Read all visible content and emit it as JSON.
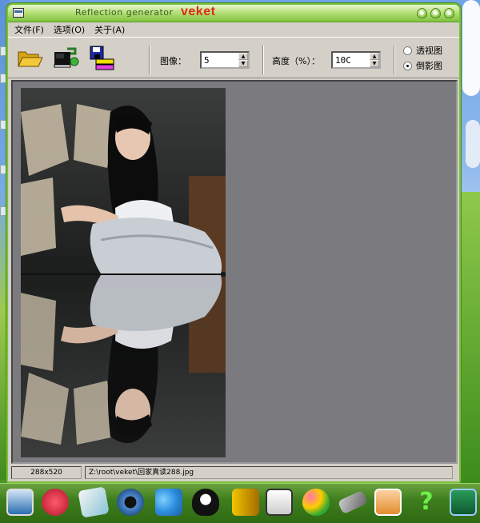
{
  "window": {
    "title": "Reflection generator",
    "brand": "veket",
    "accent_color": "#79c23b",
    "brand_color": "#e02a1a"
  },
  "menu": [
    {
      "label": "文件(F)"
    },
    {
      "label": "选项(O)"
    },
    {
      "label": "关于(A)"
    }
  ],
  "toolbar": {
    "buttons": [
      {
        "name": "open-folder-icon"
      },
      {
        "name": "export-icon"
      },
      {
        "name": "save-icon"
      }
    ],
    "image_label": "图像：",
    "image_value": "5",
    "height_label": "高度（%）：",
    "height_value": "10C",
    "radio_perspective": "透视图",
    "radio_reflection": "倒影图",
    "selected_mode": "倒影图"
  },
  "statusbar": {
    "size": "288x520",
    "path": "Z:\\root\\veket\\回家真读288.jpg"
  },
  "taskbar": {
    "icons": [
      "monitor-icon",
      "pig-icon",
      "notes-icon",
      "speaker-icon",
      "network-icon",
      "penguin-icon",
      "door-icon",
      "image-viewer-icon",
      "paint-icon",
      "tools-icon",
      "photo-icon",
      "help-icon",
      "camera-icon"
    ]
  }
}
